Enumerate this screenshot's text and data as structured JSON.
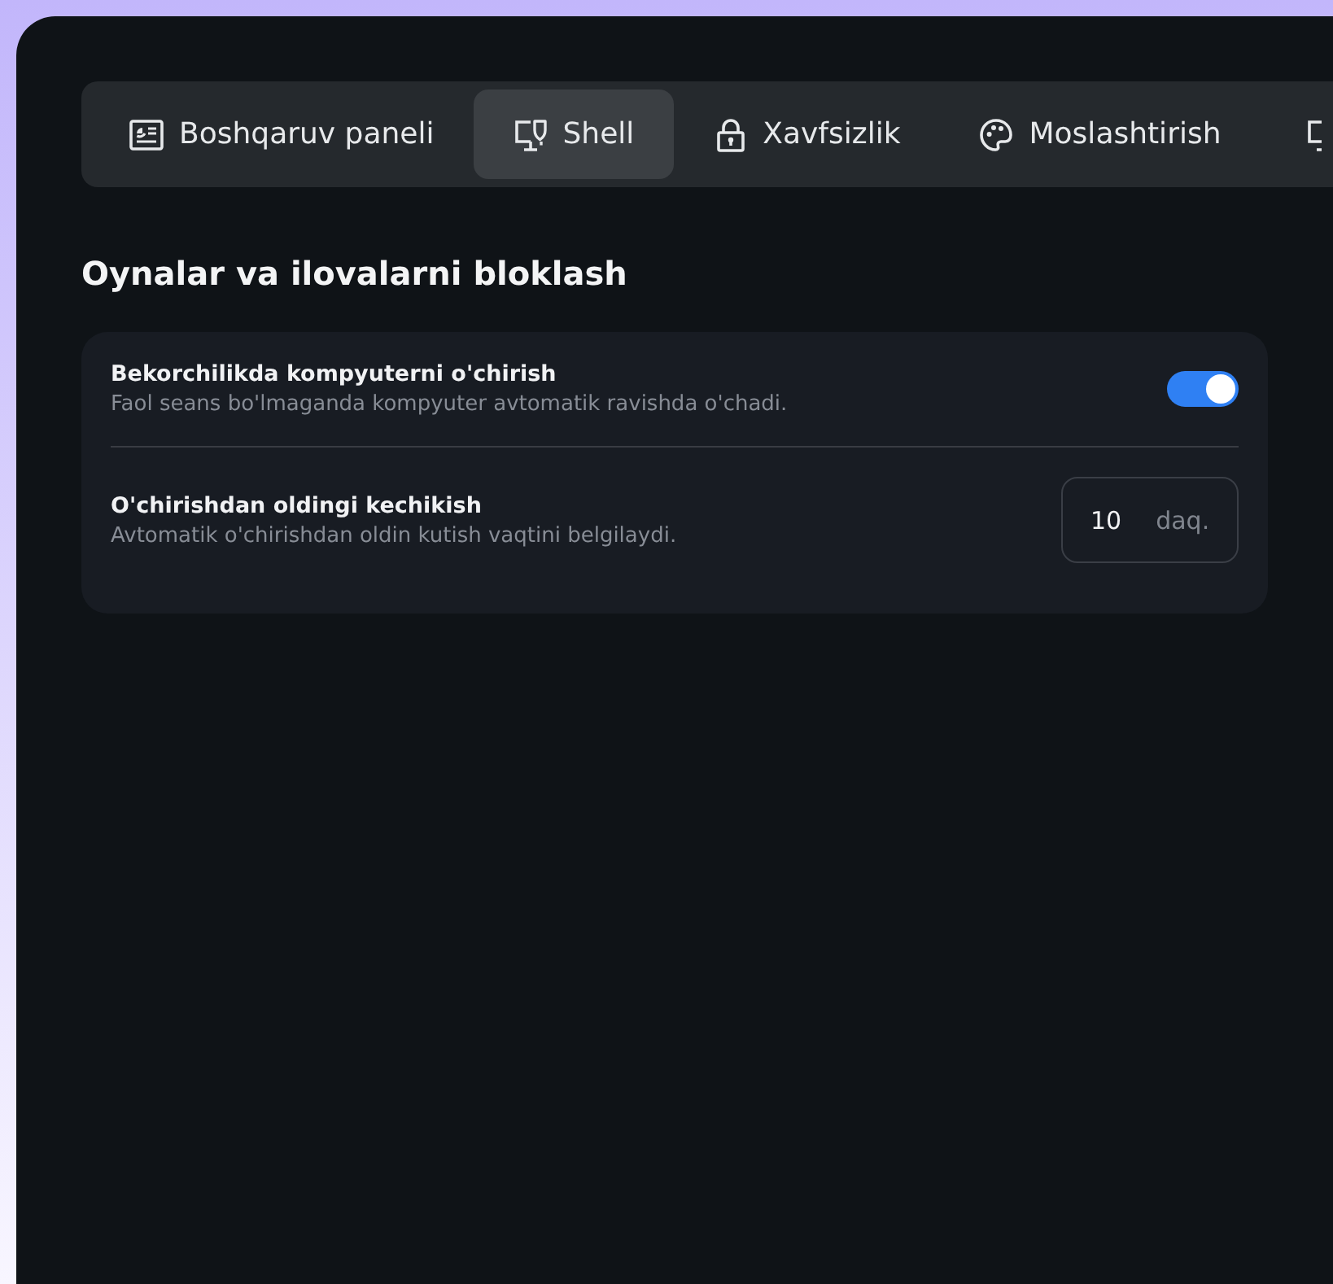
{
  "tabs": [
    {
      "label": "Boshqaruv paneli",
      "selected": false
    },
    {
      "label": "Shell",
      "selected": true
    },
    {
      "label": "Xavfsizlik",
      "selected": false
    },
    {
      "label": "Moslashtirish",
      "selected": false
    },
    {
      "selected": false
    }
  ],
  "section": {
    "title": "Oynalar va ilovalarni bloklash",
    "settings": [
      {
        "kind": "toggle",
        "title": "Bekorchilikda kompyuterni o'chirish",
        "description": "Faol seans bo'lmaganda kompyuter avtomatik ravishda o'chadi.",
        "on": true
      },
      {
        "kind": "number",
        "title": "O'chirishdan oldingi kechikish",
        "description": "Avtomatik o'chirishdan oldin kutish vaqtini belgilaydi.",
        "value": "10",
        "unit": "daq."
      }
    ]
  }
}
